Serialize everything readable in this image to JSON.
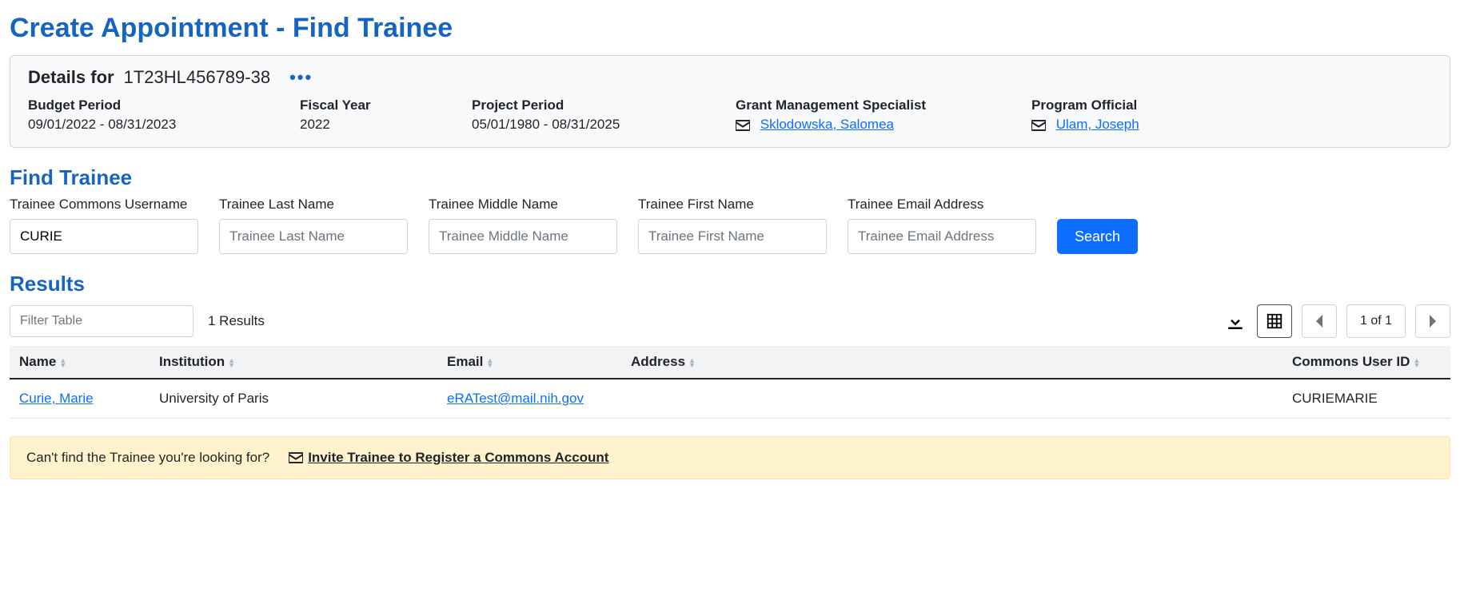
{
  "page": {
    "title": "Create Appointment - Find Trainee"
  },
  "details": {
    "label": "Details for",
    "grant_number": "1T23HL456789-38",
    "fields": {
      "budget_period": {
        "label": "Budget Period",
        "value": "09/01/2022 - 08/31/2023"
      },
      "fiscal_year": {
        "label": "Fiscal Year",
        "value": "2022"
      },
      "project_period": {
        "label": "Project Period",
        "value": "05/01/1980 - 08/31/2025"
      },
      "gms": {
        "label": "Grant Management Specialist",
        "value": "Sklodowska, Salomea"
      },
      "po": {
        "label": "Program Official",
        "value": "Ulam, Joseph"
      }
    }
  },
  "find": {
    "heading": "Find Trainee",
    "fields": {
      "username": {
        "label": "Trainee Commons Username",
        "placeholder": "Trainee Commons Username",
        "value": "CURIE"
      },
      "lastname": {
        "label": "Trainee Last Name",
        "placeholder": "Trainee Last Name",
        "value": ""
      },
      "middlename": {
        "label": "Trainee Middle Name",
        "placeholder": "Trainee Middle Name",
        "value": ""
      },
      "firstname": {
        "label": "Trainee First Name",
        "placeholder": "Trainee First Name",
        "value": ""
      },
      "email": {
        "label": "Trainee Email Address",
        "placeholder": "Trainee Email Address",
        "value": ""
      }
    },
    "search_label": "Search"
  },
  "results": {
    "heading": "Results",
    "filter_placeholder": "Filter Table",
    "count_text": "1 Results",
    "page_text": "1 of 1",
    "columns": {
      "name": "Name",
      "institution": "Institution",
      "email": "Email",
      "address": "Address",
      "commons_id": "Commons User ID"
    },
    "rows": [
      {
        "name": "Curie, Marie",
        "institution": "University of Paris",
        "email": "eRATest@mail.nih.gov",
        "address": "",
        "commons_id": "CURIEMARIE"
      }
    ]
  },
  "alert": {
    "question": "Can't find the Trainee you're looking for?",
    "invite_label": "Invite Trainee to Register a Commons Account"
  }
}
